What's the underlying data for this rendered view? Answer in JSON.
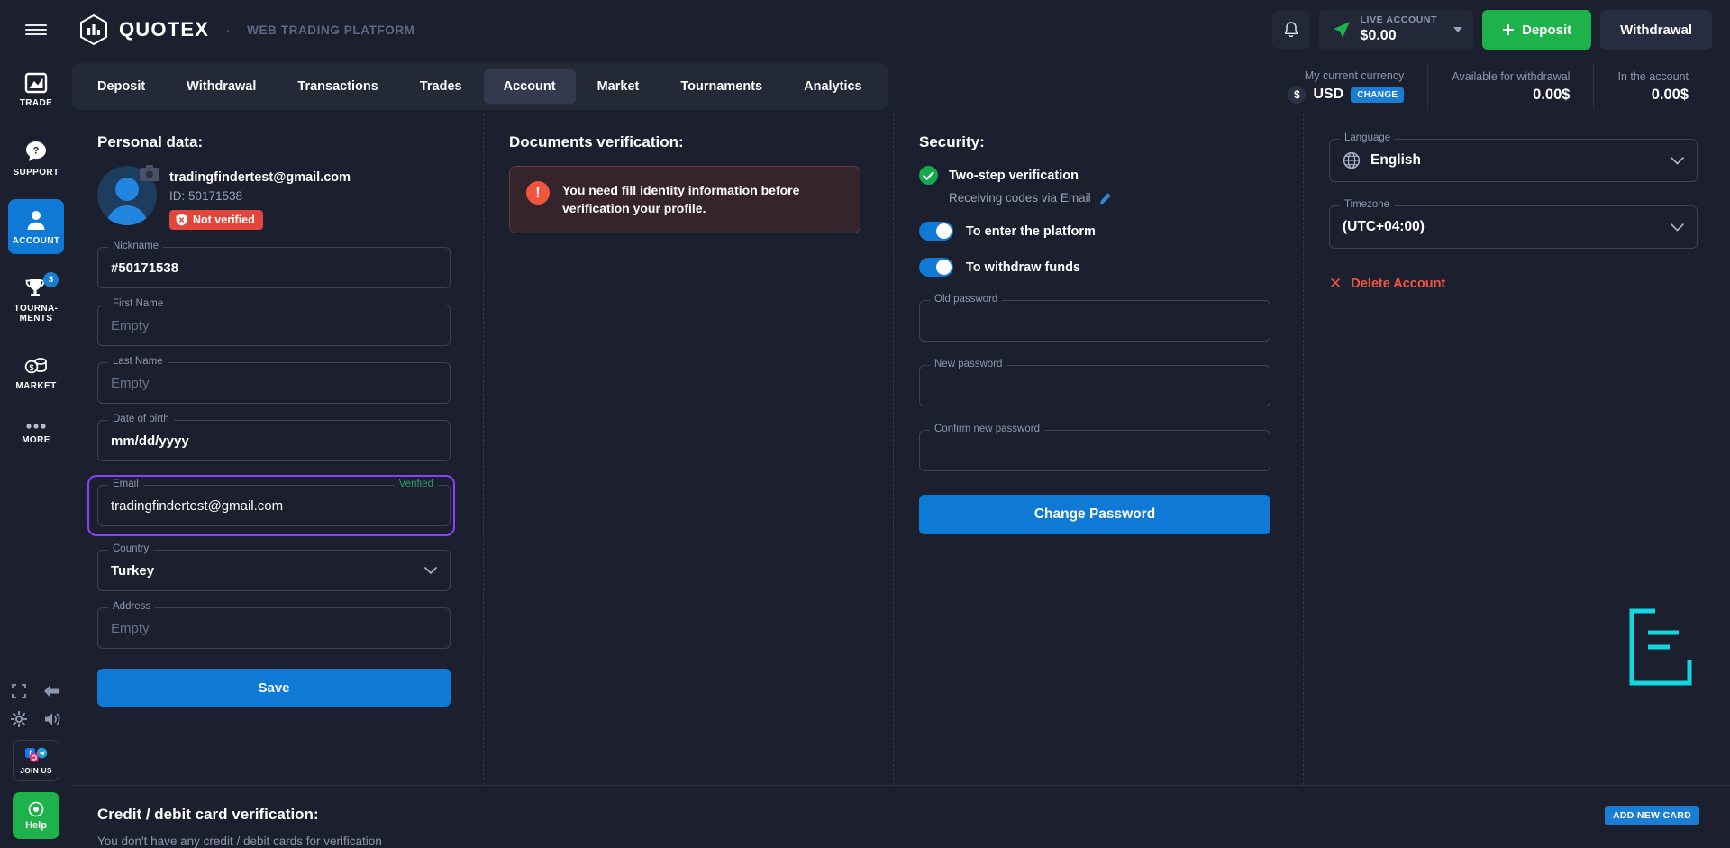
{
  "brand": {
    "name": "QUOTEX",
    "subtitle": "WEB TRADING PLATFORM",
    "dot": "·"
  },
  "header": {
    "notifications_icon": "bell-icon",
    "account_type_label": "LIVE ACCOUNT",
    "account_balance": "$0.00",
    "deposit_label": "Deposit",
    "withdrawal_label": "Withdrawal"
  },
  "sidebar": {
    "items": [
      {
        "label": "TRADE",
        "icon": "chart-image-icon",
        "active": false,
        "badge": ""
      },
      {
        "label": "SUPPORT",
        "icon": "question-bubble-icon",
        "active": false,
        "badge": ""
      },
      {
        "label": "ACCOUNT",
        "icon": "user-icon",
        "active": true,
        "badge": ""
      },
      {
        "label": "TOURNA-MENTS",
        "icon": "trophy-icon",
        "active": false,
        "badge": "3"
      },
      {
        "label": "MARKET",
        "icon": "coins-icon",
        "active": false,
        "badge": ""
      },
      {
        "label": "MORE",
        "icon": "ellipsis-icon",
        "active": false,
        "badge": ""
      }
    ],
    "bottom": {
      "fullscreen_icon": "fullscreen-icon",
      "collapse_icon": "arrow-left-icon",
      "settings_icon": "gear-icon",
      "sound_icon": "speaker-icon",
      "join_us_label": "JOIN US",
      "help_label": "Help"
    }
  },
  "tabs": [
    {
      "label": "Deposit",
      "active": false
    },
    {
      "label": "Withdrawal",
      "active": false
    },
    {
      "label": "Transactions",
      "active": false
    },
    {
      "label": "Trades",
      "active": false
    },
    {
      "label": "Account",
      "active": true
    },
    {
      "label": "Market",
      "active": false
    },
    {
      "label": "Tournaments",
      "active": false
    },
    {
      "label": "Analytics",
      "active": false
    }
  ],
  "head_stats": {
    "currency_label": "My current currency",
    "currency_symbol": "$",
    "currency_code": "USD",
    "currency_change_label": "CHANGE",
    "available_label": "Available for withdrawal",
    "available_value": "0.00$",
    "in_account_label": "In the account",
    "in_account_value": "0.00$"
  },
  "personal": {
    "title": "Personal data:",
    "email": "tradingfindertest@gmail.com",
    "id_text": "ID: 50171538",
    "not_verified_label": "Not verified",
    "camera_icon": "camera-icon",
    "fields": [
      {
        "legend": "Nickname",
        "value": "#50171538",
        "placeholder": "",
        "type": "text"
      },
      {
        "legend": "First Name",
        "value": "",
        "placeholder": "Empty",
        "type": "text"
      },
      {
        "legend": "Last Name",
        "value": "",
        "placeholder": "Empty",
        "type": "text"
      },
      {
        "legend": "Date of birth",
        "value": "mm/dd/yyyy",
        "placeholder": "",
        "type": "date"
      },
      {
        "legend": "Email",
        "value": "tradingfindertest@gmail.com",
        "placeholder": "",
        "type": "email",
        "badge": "Verified",
        "focused": true
      },
      {
        "legend": "Country",
        "value": "Turkey",
        "placeholder": "",
        "type": "select"
      },
      {
        "legend": "Address",
        "value": "",
        "placeholder": "Empty",
        "type": "text"
      }
    ],
    "save_label": "Save"
  },
  "documents": {
    "title": "Documents verification:",
    "alert_text": "You need fill identity information before verification your profile."
  },
  "security": {
    "title": "Security:",
    "two_step_label": "Two-step verification",
    "two_step_sub": "Receiving codes via Email",
    "edit_icon": "pencil-icon",
    "toggles": [
      {
        "label": "To enter the platform",
        "on": true
      },
      {
        "label": "To withdraw funds",
        "on": true
      }
    ],
    "password_fields": [
      {
        "legend": "Old password",
        "value": ""
      },
      {
        "legend": "New password",
        "value": ""
      },
      {
        "legend": "Confirm new password",
        "value": ""
      }
    ],
    "change_password_label": "Change Password"
  },
  "settings": {
    "language_legend": "Language",
    "language_value": "English",
    "language_icon": "globe-icon",
    "timezone_legend": "Timezone",
    "timezone_value": "(UTC+04:00)",
    "delete_label": "Delete Account"
  },
  "bottom": {
    "title": "Credit / debit card verification:",
    "subtitle": "You don't have any credit / debit cards for verification",
    "add_card_label": "ADD NEW CARD"
  },
  "colors": {
    "accent_blue": "#0e7ad6",
    "green": "#1eb34a",
    "red": "#f0563f",
    "purple_focus": "#8a3ffc",
    "bg": "#1b1f2e"
  }
}
